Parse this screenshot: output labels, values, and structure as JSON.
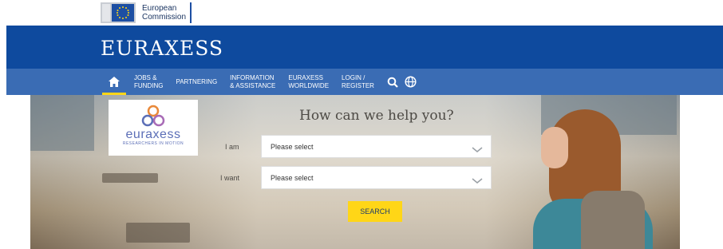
{
  "header": {
    "ec_line1": "European",
    "ec_line2": "Commission",
    "brand": "EURAXESS"
  },
  "nav": {
    "items": [
      {
        "label": "JOBS &\nFUNDING"
      },
      {
        "label": "PARTNERING"
      },
      {
        "label": "INFORMATION\n& ASSISTANCE"
      },
      {
        "label": "EURAXESS\nWORLDWIDE"
      },
      {
        "label": "LOGIN /\nREGISTER"
      }
    ]
  },
  "hero": {
    "logo_word": "euraxess",
    "logo_tagline": "RESEARCHERS IN MOTION",
    "title": "How can we help you?",
    "i_am_label": "I am",
    "i_am_value": "Please select",
    "i_want_label": "I want",
    "i_want_value": "Please select",
    "search_label": "SEARCH"
  },
  "colors": {
    "brand_blue": "#0e4a9e",
    "nav_blue": "#3a6cb4",
    "accent_yellow": "#ffd617"
  }
}
